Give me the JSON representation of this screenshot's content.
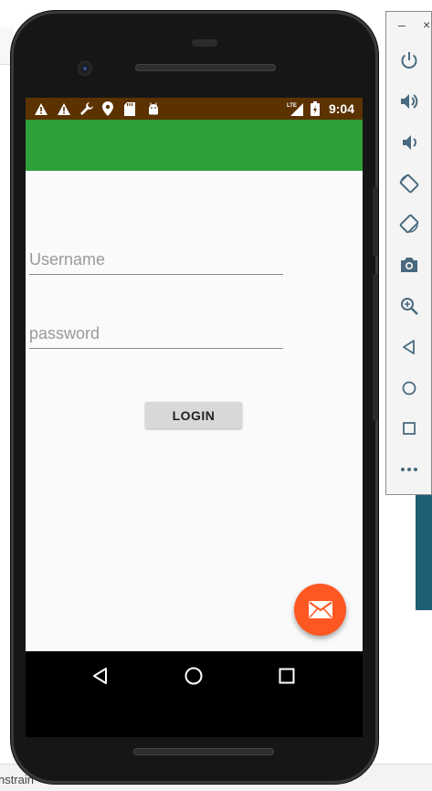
{
  "ide": {
    "bottom_text": "nstrain"
  },
  "statusbar": {
    "time": "9:04",
    "icons": [
      "warning-icon",
      "warning-icon",
      "wrench-icon",
      "location-icon",
      "sdcard-icon",
      "android-icon",
      "lte-icon",
      "battery-icon"
    ],
    "lte_label": "LTE"
  },
  "appbar": {
    "color": "#2ea039"
  },
  "form": {
    "username_placeholder": "Username",
    "username_value": "",
    "password_placeholder": "password",
    "password_value": "",
    "login_label": "LOGIN"
  },
  "fab": {
    "icon": "mail-icon",
    "color": "#ff5722"
  },
  "navbar": {
    "icons": [
      "back-icon",
      "home-icon",
      "recents-icon"
    ]
  },
  "emulator_toolbar": {
    "window_controls": [
      "minimize",
      "close"
    ],
    "minimize_label": "–",
    "close_label": "×",
    "buttons": [
      "power-icon",
      "volume-up-icon",
      "volume-down-icon",
      "rotate-left-icon",
      "rotate-right-icon",
      "camera-icon",
      "zoom-icon",
      "back-icon",
      "home-icon",
      "overview-icon",
      "more-icon"
    ]
  },
  "colors": {
    "statusbar": "#5b3200",
    "accent": "#ff5722",
    "primary": "#2ea039"
  }
}
